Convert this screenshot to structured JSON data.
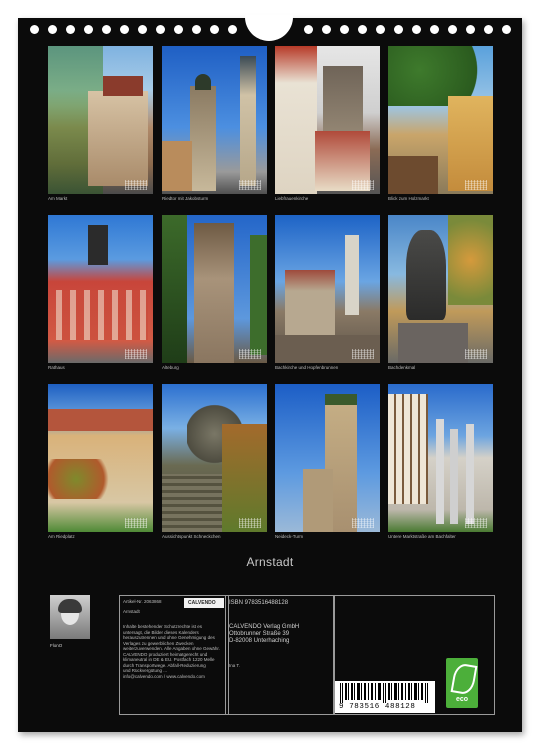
{
  "photos": [
    {
      "caption": "Am Markt"
    },
    {
      "caption": "Riedtor mit Jakobsturm"
    },
    {
      "caption": "Liebfrauenkirche"
    },
    {
      "caption": "Blick zum Holzmarkt"
    },
    {
      "caption": "Rathaus"
    },
    {
      "caption": "Alteburg"
    },
    {
      "caption": "Bachkirche und Hopfenbrunnen"
    },
    {
      "caption": "Bachdenkmal"
    },
    {
      "caption": "Am Riedplatz"
    },
    {
      "caption": "Aussichtspunkt Schneckchen"
    },
    {
      "caption": "Neideck-Turm"
    },
    {
      "caption": "Untere Marktstraße am Bachfalter"
    }
  ],
  "title": "Arnstadt",
  "author": {
    "name": "FlonO"
  },
  "info": {
    "article": "Artikel-Nr. 2063868",
    "calendar_name": "Arnstadt",
    "brand": "CALVENDO",
    "isbn": "ISBN 9783516488128",
    "publisher_lines": [
      "CALVENDO Verlag GmbH",
      "Ottobrunner Straße 39",
      "D-82008 Unterhaching"
    ],
    "copyright_lines": [
      "Inhalte bestehender Schutzrechte ist es",
      "untersagt, die Bilder dieses Kalenders",
      "herauszutrennen und ohne Genehmigung des",
      "Verlages zu gewerblichen Zwecken",
      "weiterzuverwenden. Alle Angaben ohne Gewähr.",
      "CALVENDO produziert heimatgerecht und",
      "klimaneutral in DE & EU. Postfach 1220 Melle",
      "durch Transportwege. Abfall-Reduzierung",
      "und Rückvergütung ...",
      "info@calvendo.com / www.calvendo.com"
    ],
    "rights_holder": "Ina T.",
    "barcode_digits": "9 783516 488128"
  },
  "eco_label": "eco"
}
